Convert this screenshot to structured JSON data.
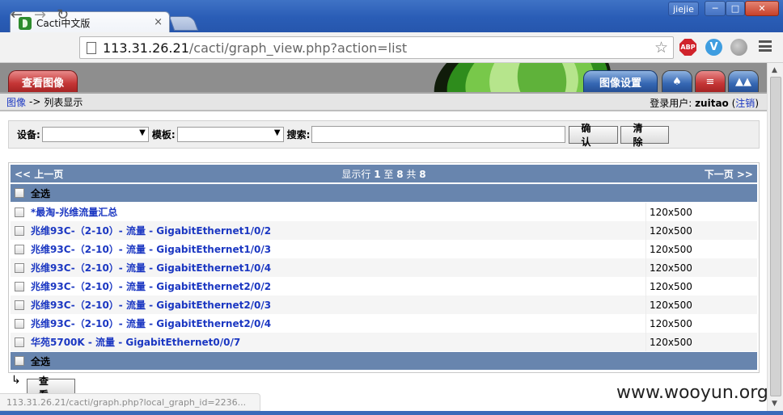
{
  "browser": {
    "tab_title": "Cacti中文版",
    "tab_close": "×",
    "user_badge": "jiejie",
    "win_min": "─",
    "win_max": "□",
    "win_close": "✕",
    "nav_back": "←",
    "nav_forward": "→",
    "nav_reload": "↻",
    "url_host": "113.31.26.21",
    "url_path": "/cacti/graph_view.php?action=list",
    "star": "☆",
    "ext_abp": "ABP",
    "ext_v": "V",
    "icons": [
      "back-icon",
      "forward-icon",
      "reload-icon",
      "page-icon",
      "star-icon",
      "adblock-icon",
      "v-extension-icon",
      "globe-icon",
      "menu-icon"
    ]
  },
  "header": {
    "tab_graphs": "查看图像",
    "tab_settings": "图像设置",
    "icon_tree": "♠",
    "icon_list": "≡",
    "icon_preview": "▲▲"
  },
  "breadcrumb": {
    "link": "图像",
    "sep": "->",
    "current": "列表显示",
    "login_label": "登录用户:",
    "user": "zuitao",
    "logout_open": "(",
    "logout": "注销",
    "logout_close": ")"
  },
  "filter": {
    "device_label": "设备:",
    "device_value": "",
    "template_label": "模板:",
    "template_value": "",
    "search_label": "搜索:",
    "search_value": "",
    "confirm": "确认",
    "clear": "清除"
  },
  "list": {
    "prev": "<< 上一页",
    "next": "下一页 >>",
    "info_prefix": "显示行",
    "from": "1",
    "to_word": "至",
    "to": "8",
    "total_word": "共",
    "total": "8",
    "select_all": "全选",
    "rows": [
      {
        "title": "*最淘-兆维流量汇总",
        "size": "120x500"
      },
      {
        "title": "兆维93C-（2-10）- 流量 - GigabitEthernet1/0/2",
        "size": "120x500"
      },
      {
        "title": "兆维93C-（2-10）- 流量 - GigabitEthernet1/0/3",
        "size": "120x500"
      },
      {
        "title": "兆维93C-（2-10）- 流量 - GigabitEthernet1/0/4",
        "size": "120x500"
      },
      {
        "title": "兆维93C-（2-10）- 流量 - GigabitEthernet2/0/2",
        "size": "120x500"
      },
      {
        "title": "兆维93C-（2-10）- 流量 - GigabitEthernet2/0/3",
        "size": "120x500"
      },
      {
        "title": "兆维93C-（2-10）- 流量 - GigabitEthernet2/0/4",
        "size": "120x500"
      },
      {
        "title": "华苑5700K - 流量 - GigabitEthernet0/0/7",
        "size": "120x500"
      }
    ],
    "arrow": "↳",
    "view_button": "查看"
  },
  "status_url": "113.31.26.21/cacti/graph.php?local_graph_id=2236...",
  "watermark": "www.wooyun.org",
  "colors": {
    "title_bar": "#2a5db6",
    "nav_row": "#6885ae",
    "link": "#1b37c2",
    "tab_red": "#c43535",
    "tab_blue": "#3567b3"
  }
}
